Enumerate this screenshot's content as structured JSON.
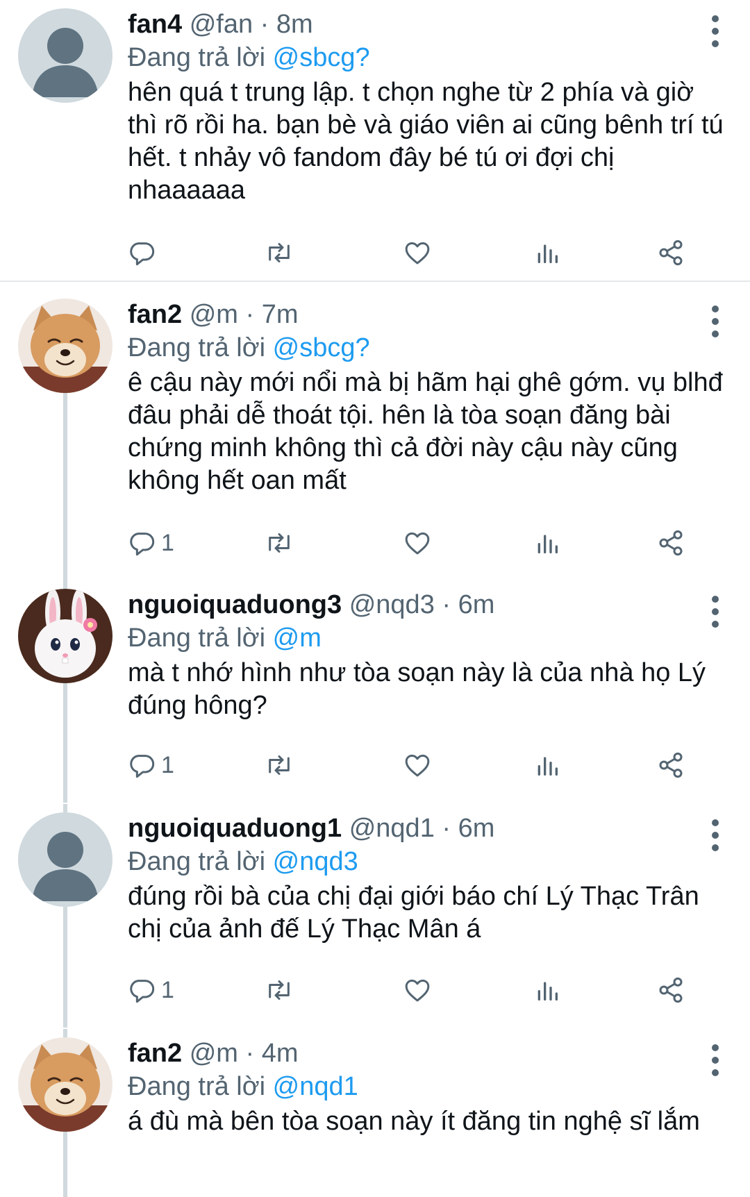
{
  "replying_prefix": "Đang trả lời",
  "tweets": [
    {
      "name": "fan4",
      "handle": "@fan",
      "time": "· 8m",
      "reply_to": "@sbcg?",
      "text": "hên quá t trung lập. t chọn nghe từ 2 phía và giờ thì rõ rồi ha. bạn bè và giáo viên ai cũng bênh trí tú hết. t nhảy vô fandom đây bé tú ơi đợi chị nhaaaaaa",
      "reply_count": "",
      "avatar": "default-avatar-icon"
    },
    {
      "name": "fan2",
      "handle": "@m",
      "time": "· 7m",
      "reply_to": "@sbcg?",
      "text": "ê cậu này mới nổi mà bị hãm hại ghê gớm. vụ blhđ đâu phải dễ thoát tội. hên là tòa soạn đăng bài chứng minh không thì cả đời này cậu này cũng không hết oan mất",
      "reply_count": "1",
      "avatar": "shiba-dog-avatar"
    },
    {
      "name": "nguoiquaduong3",
      "handle": "@nqd3",
      "time": "· 6m",
      "reply_to": "@m",
      "text": "mà t nhớ hình như tòa soạn này là của nhà họ Lý đúng hông?",
      "reply_count": "1",
      "avatar": "white-bunny-avatar"
    },
    {
      "name": "nguoiquaduong1",
      "handle": "@nqd1",
      "time": "· 6m",
      "reply_to": "@nqd3",
      "text": "đúng rồi bà của chị đại giới báo chí Lý Thạc Trân chị của ảnh đế Lý Thạc Mân á",
      "reply_count": "1",
      "avatar": "default-avatar-icon"
    },
    {
      "name": "fan2",
      "handle": "@m",
      "time": "· 4m",
      "reply_to": "@nqd1",
      "text": "á đù mà bên tòa soạn này ít đăng tin nghệ sĩ lắm",
      "reply_count": "",
      "avatar": "shiba-dog-avatar"
    }
  ],
  "colors": {
    "text": "#0f1419",
    "secondary": "#536471",
    "mention": "#1d9bf0",
    "thread_line": "#cfd9de",
    "divider": "#e4e8ea"
  }
}
